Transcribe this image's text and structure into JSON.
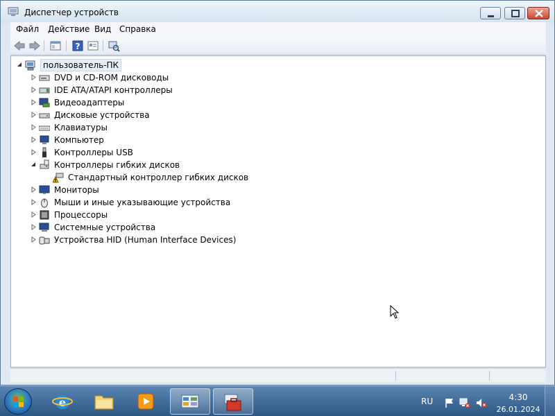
{
  "window": {
    "title": "Диспетчер устройств",
    "app_icon": "device-manager-icon",
    "buttons": [
      "minimize",
      "maximize",
      "close"
    ]
  },
  "menubar": {
    "items": [
      "Файл",
      "Действие",
      "Вид",
      "Справка"
    ]
  },
  "toolbar": {
    "icons": [
      "back-arrow-icon",
      "forward-arrow-icon",
      "show-hide-tree-icon",
      "help-icon",
      "properties-icon",
      "scan-hardware-icon"
    ]
  },
  "tree": {
    "root": {
      "label": "пользователь-ПК",
      "icon": "computer-icon",
      "expanded": true
    },
    "items": [
      {
        "label": "DVD и CD-ROM дисководы",
        "icon": "dvd-drive-icon",
        "expanded": false
      },
      {
        "label": "IDE ATA/ATAPI контроллеры",
        "icon": "ide-controller-icon",
        "expanded": false
      },
      {
        "label": "Видеоадаптеры",
        "icon": "display-adapter-icon",
        "expanded": false
      },
      {
        "label": "Дисковые устройства",
        "icon": "disk-drive-icon",
        "expanded": false
      },
      {
        "label": "Клавиатуры",
        "icon": "keyboard-icon",
        "expanded": false
      },
      {
        "label": "Компьютер",
        "icon": "computer-icon",
        "expanded": false
      },
      {
        "label": "Контроллеры USB",
        "icon": "usb-icon",
        "expanded": false
      },
      {
        "label": "Контроллеры гибких дисков",
        "icon": "floppy-controller-icon",
        "expanded": true,
        "children": [
          {
            "label": "Стандартный контроллер гибких дисков",
            "icon": "floppy-warning-icon",
            "status": "warning"
          }
        ]
      },
      {
        "label": "Мониторы",
        "icon": "monitor-icon",
        "expanded": false
      },
      {
        "label": "Мыши и иные указывающие устройства",
        "icon": "mouse-icon",
        "expanded": false
      },
      {
        "label": "Процессоры",
        "icon": "processor-icon",
        "expanded": false
      },
      {
        "label": "Системные устройства",
        "icon": "system-devices-icon",
        "expanded": false
      },
      {
        "label": "Устройства HID (Human Interface Devices)",
        "icon": "hid-icon",
        "expanded": false
      }
    ]
  },
  "taskbar": {
    "start_icon": "windows-start-icon",
    "pinned": [
      {
        "name": "internet-explorer-icon",
        "active": false
      },
      {
        "name": "explorer-folder-icon",
        "active": false
      },
      {
        "name": "media-player-icon",
        "active": false
      },
      {
        "name": "control-panel-icon",
        "active": true
      },
      {
        "name": "device-manager-toolbox-icon",
        "active": true
      }
    ],
    "language": "RU",
    "tray_icons": [
      "flag-icon",
      "network-disconnected-icon",
      "volume-muted-icon"
    ],
    "clock": {
      "time": "4:30",
      "date": "26.01.2024"
    }
  },
  "colors": {
    "taskbar_top": "#5a86b4",
    "taskbar_bottom": "#2c5684",
    "close_button": "#c74a32",
    "warning": "#f2c200"
  }
}
